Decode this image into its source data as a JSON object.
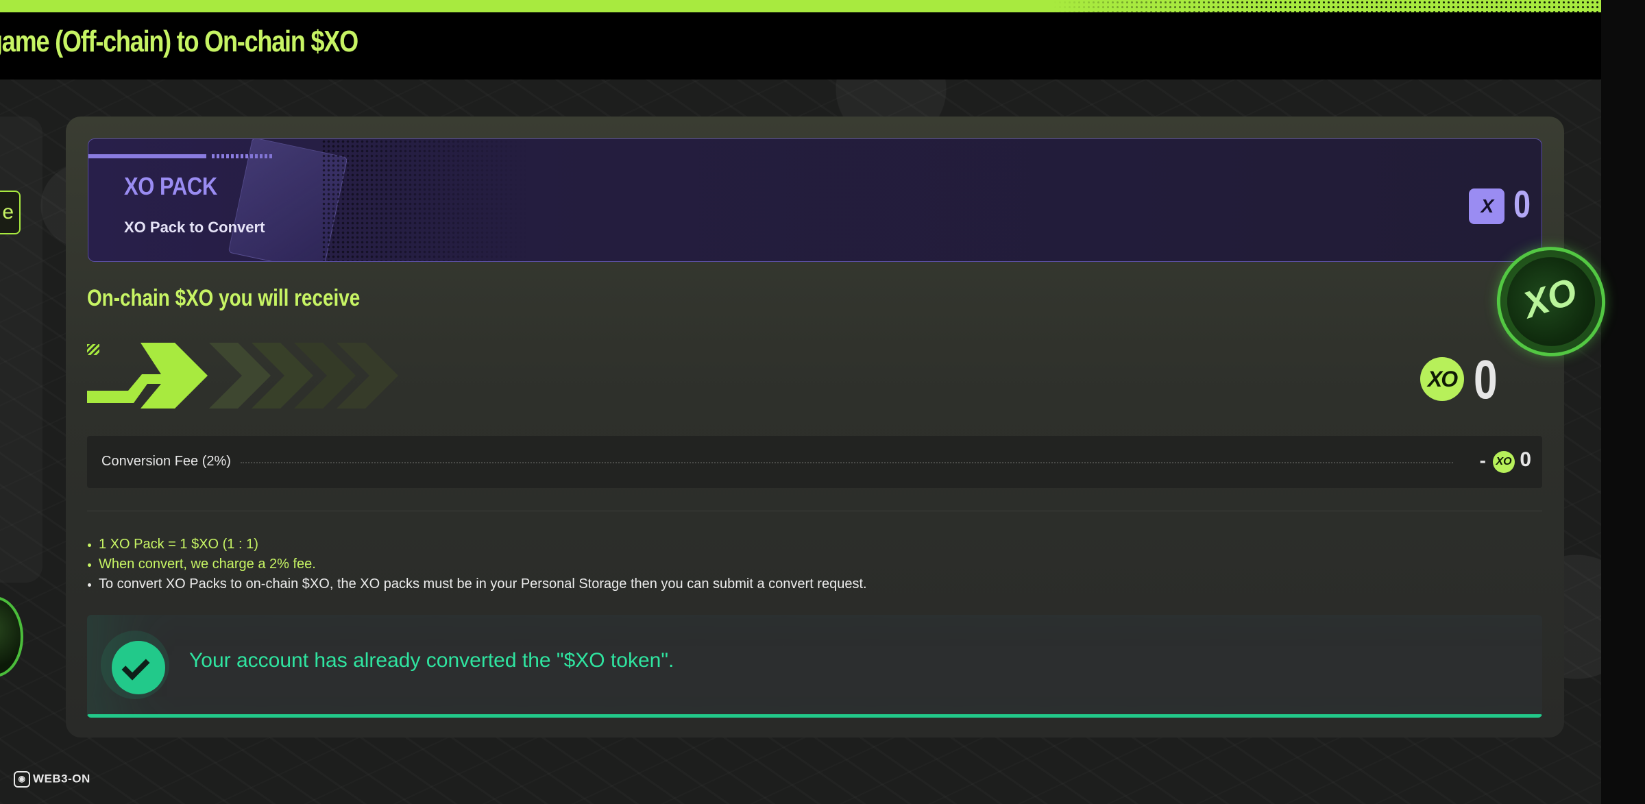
{
  "header": {
    "title": "game (Off-chain) to On-chain $XO"
  },
  "left_edge": {
    "button_label": "e"
  },
  "pack": {
    "title": "XO PACK",
    "subtitle": "XO Pack to Convert",
    "icon": "xo-pack-icon",
    "value": "0"
  },
  "receive": {
    "title": "On-chain $XO you will receive",
    "icon": "xo-coin-icon",
    "value": "0"
  },
  "fee": {
    "label": "Conversion Fee (2%)",
    "minus": "-",
    "icon": "xo-coin-icon",
    "value": "0"
  },
  "notes": [
    "1 XO Pack = 1 $XO (1 : 1)",
    "When convert, we charge a 2% fee.",
    "To convert XO Packs to on-chain $XO, the XO packs must be in your Personal Storage then you can submit a convert request."
  ],
  "success": {
    "icon": "check-icon",
    "message": "Your account has already converted the \"$XO token\"."
  },
  "footer": {
    "brand": "WEB3-ON"
  },
  "colors": {
    "accent_lime": "#c7f464",
    "pack_purple": "#9a8cf2",
    "success_green": "#22c98a",
    "background": "#1d1e1d"
  }
}
